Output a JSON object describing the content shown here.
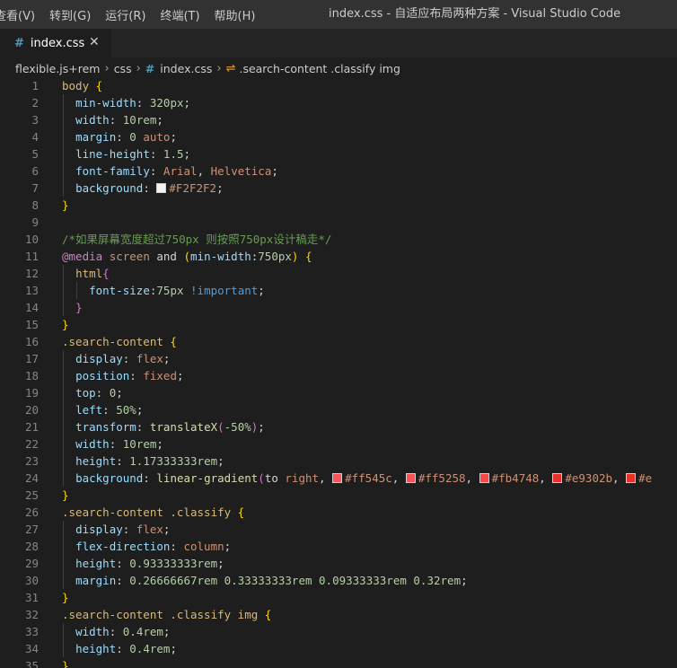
{
  "titlebar": {
    "menu": [
      "查看(V)",
      "转到(G)",
      "运行(R)",
      "终端(T)",
      "帮助(H)"
    ],
    "title": "index.css - 自适应布局两种方案 - Visual Studio Code"
  },
  "tab": {
    "icon": "css-file-icon",
    "label": "index.css",
    "close_icon": "close-icon"
  },
  "breadcrumb": {
    "items": [
      "flexible.js+rem",
      "css",
      "index.css",
      ".search-content .classify img"
    ]
  },
  "colors": {
    "background": "#1e1e1e",
    "titlebar": "#323233",
    "tabbar": "#252526",
    "comment": "#6a9955",
    "selector": "#d7ba7d",
    "property": "#9cdcfe",
    "value": "#ce9178",
    "number": "#b5cea8",
    "swatch_F2F2F2": "#F2F2F2",
    "swatch_ff545c": "#ff545c",
    "swatch_ff5258": "#ff5258",
    "swatch_fb4748": "#fb4748",
    "swatch_e9302b": "#e9302b"
  },
  "editor": {
    "lines": [
      {
        "n": "1",
        "segs": [
          [
            "ty",
            "body "
          ],
          [
            "b1",
            "{"
          ]
        ]
      },
      {
        "n": "2",
        "segs": [
          [
            "pn",
            "  "
          ],
          [
            "pr",
            "min-width"
          ],
          [
            "pn",
            ": "
          ],
          [
            "nm",
            "320"
          ],
          [
            "un",
            "px"
          ],
          [
            "pn",
            ";"
          ]
        ]
      },
      {
        "n": "3",
        "segs": [
          [
            "pn",
            "  "
          ],
          [
            "pr",
            "width"
          ],
          [
            "pn",
            ": "
          ],
          [
            "nm",
            "10"
          ],
          [
            "un",
            "rem"
          ],
          [
            "pn",
            ";"
          ]
        ]
      },
      {
        "n": "4",
        "segs": [
          [
            "pn",
            "  "
          ],
          [
            "pr",
            "margin"
          ],
          [
            "pn",
            ": "
          ],
          [
            "nm",
            "0"
          ],
          [
            "pn",
            " "
          ],
          [
            "vl",
            "auto"
          ],
          [
            "pn",
            ";"
          ]
        ]
      },
      {
        "n": "5",
        "segs": [
          [
            "pn",
            "  "
          ],
          [
            "pr",
            "line-height"
          ],
          [
            "pn",
            ": "
          ],
          [
            "nm",
            "1.5"
          ],
          [
            "pn",
            ";"
          ]
        ]
      },
      {
        "n": "6",
        "segs": [
          [
            "pn",
            "  "
          ],
          [
            "pr",
            "font-family"
          ],
          [
            "pn",
            ": "
          ],
          [
            "vl",
            "Arial"
          ],
          [
            "pn",
            ", "
          ],
          [
            "vl",
            "Helvetica"
          ],
          [
            "pn",
            ";"
          ]
        ]
      },
      {
        "n": "7",
        "segs": [
          [
            "pn",
            "  "
          ],
          [
            "pr",
            "background"
          ],
          [
            "pn",
            ": "
          ],
          [
            "sw",
            "#F2F2F2"
          ],
          [
            "vl",
            "#F2F2F2"
          ],
          [
            "pn",
            ";"
          ]
        ]
      },
      {
        "n": "8",
        "segs": [
          [
            "b1",
            "}"
          ]
        ]
      },
      {
        "n": "9",
        "segs": []
      },
      {
        "n": "10",
        "segs": [
          [
            "cm",
            "/*如果屏幕宽度超过750px 则按照750px设计稿走*/"
          ]
        ]
      },
      {
        "n": "11",
        "segs": [
          [
            "kw",
            "@media"
          ],
          [
            "pn",
            " "
          ],
          [
            "vl",
            "screen"
          ],
          [
            "pn",
            " and "
          ],
          [
            "b1",
            "("
          ],
          [
            "pr",
            "min-width"
          ],
          [
            "pn",
            ":"
          ],
          [
            "nm",
            "750"
          ],
          [
            "un",
            "px"
          ],
          [
            "b1",
            ")"
          ],
          [
            "pn",
            " "
          ],
          [
            "b1",
            "{"
          ]
        ]
      },
      {
        "n": "12",
        "segs": [
          [
            "pn",
            "  "
          ],
          [
            "ty",
            "html"
          ],
          [
            "b2",
            "{"
          ]
        ]
      },
      {
        "n": "13",
        "segs": [
          [
            "pn",
            "    "
          ],
          [
            "pr",
            "font-size"
          ],
          [
            "pn",
            ":"
          ],
          [
            "nm",
            "75"
          ],
          [
            "un",
            "px"
          ],
          [
            "pn",
            " "
          ],
          [
            "ik",
            "!important"
          ],
          [
            "pn",
            ";"
          ]
        ]
      },
      {
        "n": "14",
        "segs": [
          [
            "pn",
            "  "
          ],
          [
            "b2",
            "}"
          ]
        ]
      },
      {
        "n": "15",
        "segs": [
          [
            "b1",
            "}"
          ]
        ]
      },
      {
        "n": "16",
        "segs": [
          [
            "ty",
            ".search-content "
          ],
          [
            "b1",
            "{"
          ]
        ]
      },
      {
        "n": "17",
        "segs": [
          [
            "pn",
            "  "
          ],
          [
            "pr",
            "display"
          ],
          [
            "pn",
            ": "
          ],
          [
            "vl",
            "flex"
          ],
          [
            "pn",
            ";"
          ]
        ]
      },
      {
        "n": "18",
        "segs": [
          [
            "pn",
            "  "
          ],
          [
            "pr",
            "position"
          ],
          [
            "pn",
            ": "
          ],
          [
            "vl",
            "fixed"
          ],
          [
            "pn",
            ";"
          ]
        ]
      },
      {
        "n": "19",
        "segs": [
          [
            "pn",
            "  "
          ],
          [
            "pr",
            "top"
          ],
          [
            "pn",
            ": "
          ],
          [
            "nm",
            "0"
          ],
          [
            "pn",
            ";"
          ]
        ]
      },
      {
        "n": "20",
        "segs": [
          [
            "pn",
            "  "
          ],
          [
            "pr",
            "left"
          ],
          [
            "pn",
            ": "
          ],
          [
            "nm",
            "50"
          ],
          [
            "un",
            "%"
          ],
          [
            "pn",
            ";"
          ]
        ]
      },
      {
        "n": "21",
        "segs": [
          [
            "pn",
            "  "
          ],
          [
            "pr",
            "transform"
          ],
          [
            "pn",
            ": "
          ],
          [
            "fn",
            "translateX"
          ],
          [
            "b2",
            "("
          ],
          [
            "nm",
            "-50"
          ],
          [
            "un",
            "%"
          ],
          [
            "b2",
            ")"
          ],
          [
            "pn",
            ";"
          ]
        ]
      },
      {
        "n": "22",
        "segs": [
          [
            "pn",
            "  "
          ],
          [
            "pr",
            "width"
          ],
          [
            "pn",
            ": "
          ],
          [
            "nm",
            "10"
          ],
          [
            "un",
            "rem"
          ],
          [
            "pn",
            ";"
          ]
        ]
      },
      {
        "n": "23",
        "segs": [
          [
            "pn",
            "  "
          ],
          [
            "pr",
            "height"
          ],
          [
            "pn",
            ": "
          ],
          [
            "nm",
            "1.17333333"
          ],
          [
            "un",
            "rem"
          ],
          [
            "pn",
            ";"
          ]
        ]
      },
      {
        "n": "24",
        "segs": [
          [
            "pn",
            "  "
          ],
          [
            "pr",
            "background"
          ],
          [
            "pn",
            ": "
          ],
          [
            "fn",
            "linear-gradient"
          ],
          [
            "b2",
            "("
          ],
          [
            "pn",
            "to "
          ],
          [
            "vl",
            "right"
          ],
          [
            "pn",
            ", "
          ],
          [
            "sw",
            "#ff545c"
          ],
          [
            "vl",
            "#ff545c"
          ],
          [
            "pn",
            ", "
          ],
          [
            "sw",
            "#ff5258"
          ],
          [
            "vl",
            "#ff5258"
          ],
          [
            "pn",
            ", "
          ],
          [
            "sw",
            "#fb4748"
          ],
          [
            "vl",
            "#fb4748"
          ],
          [
            "pn",
            ", "
          ],
          [
            "sw",
            "#e9302b"
          ],
          [
            "vl",
            "#e9302b"
          ],
          [
            "pn",
            ", "
          ],
          [
            "sw",
            "#e9302b"
          ],
          [
            "vl",
            "#e"
          ]
        ]
      },
      {
        "n": "25",
        "segs": [
          [
            "b1",
            "}"
          ]
        ]
      },
      {
        "n": "26",
        "segs": [
          [
            "ty",
            ".search-content .classify "
          ],
          [
            "b1",
            "{"
          ]
        ]
      },
      {
        "n": "27",
        "segs": [
          [
            "pn",
            "  "
          ],
          [
            "pr",
            "display"
          ],
          [
            "pn",
            ": "
          ],
          [
            "vl",
            "flex"
          ],
          [
            "pn",
            ";"
          ]
        ]
      },
      {
        "n": "28",
        "segs": [
          [
            "pn",
            "  "
          ],
          [
            "pr",
            "flex-direction"
          ],
          [
            "pn",
            ": "
          ],
          [
            "vl",
            "column"
          ],
          [
            "pn",
            ";"
          ]
        ]
      },
      {
        "n": "29",
        "segs": [
          [
            "pn",
            "  "
          ],
          [
            "pr",
            "height"
          ],
          [
            "pn",
            ": "
          ],
          [
            "nm",
            "0.93333333"
          ],
          [
            "un",
            "rem"
          ],
          [
            "pn",
            ";"
          ]
        ]
      },
      {
        "n": "30",
        "segs": [
          [
            "pn",
            "  "
          ],
          [
            "pr",
            "margin"
          ],
          [
            "pn",
            ": "
          ],
          [
            "nm",
            "0.26666667"
          ],
          [
            "un",
            "rem"
          ],
          [
            "pn",
            " "
          ],
          [
            "nm",
            "0.33333333"
          ],
          [
            "un",
            "rem"
          ],
          [
            "pn",
            " "
          ],
          [
            "nm",
            "0.09333333"
          ],
          [
            "un",
            "rem"
          ],
          [
            "pn",
            " "
          ],
          [
            "nm",
            "0.32"
          ],
          [
            "un",
            "rem"
          ],
          [
            "pn",
            ";"
          ]
        ]
      },
      {
        "n": "31",
        "segs": [
          [
            "b1",
            "}"
          ]
        ]
      },
      {
        "n": "32",
        "segs": [
          [
            "ty",
            ".search-content .classify img "
          ],
          [
            "b1",
            "{"
          ]
        ]
      },
      {
        "n": "33",
        "segs": [
          [
            "pn",
            "  "
          ],
          [
            "pr",
            "width"
          ],
          [
            "pn",
            ": "
          ],
          [
            "nm",
            "0.4"
          ],
          [
            "un",
            "rem"
          ],
          [
            "pn",
            ";"
          ]
        ]
      },
      {
        "n": "34",
        "segs": [
          [
            "pn",
            "  "
          ],
          [
            "pr",
            "height"
          ],
          [
            "pn",
            ": "
          ],
          [
            "nm",
            "0.4"
          ],
          [
            "un",
            "rem"
          ],
          [
            "pn",
            ";"
          ]
        ]
      },
      {
        "n": "35",
        "segs": [
          [
            "b1",
            "}"
          ]
        ]
      }
    ]
  }
}
